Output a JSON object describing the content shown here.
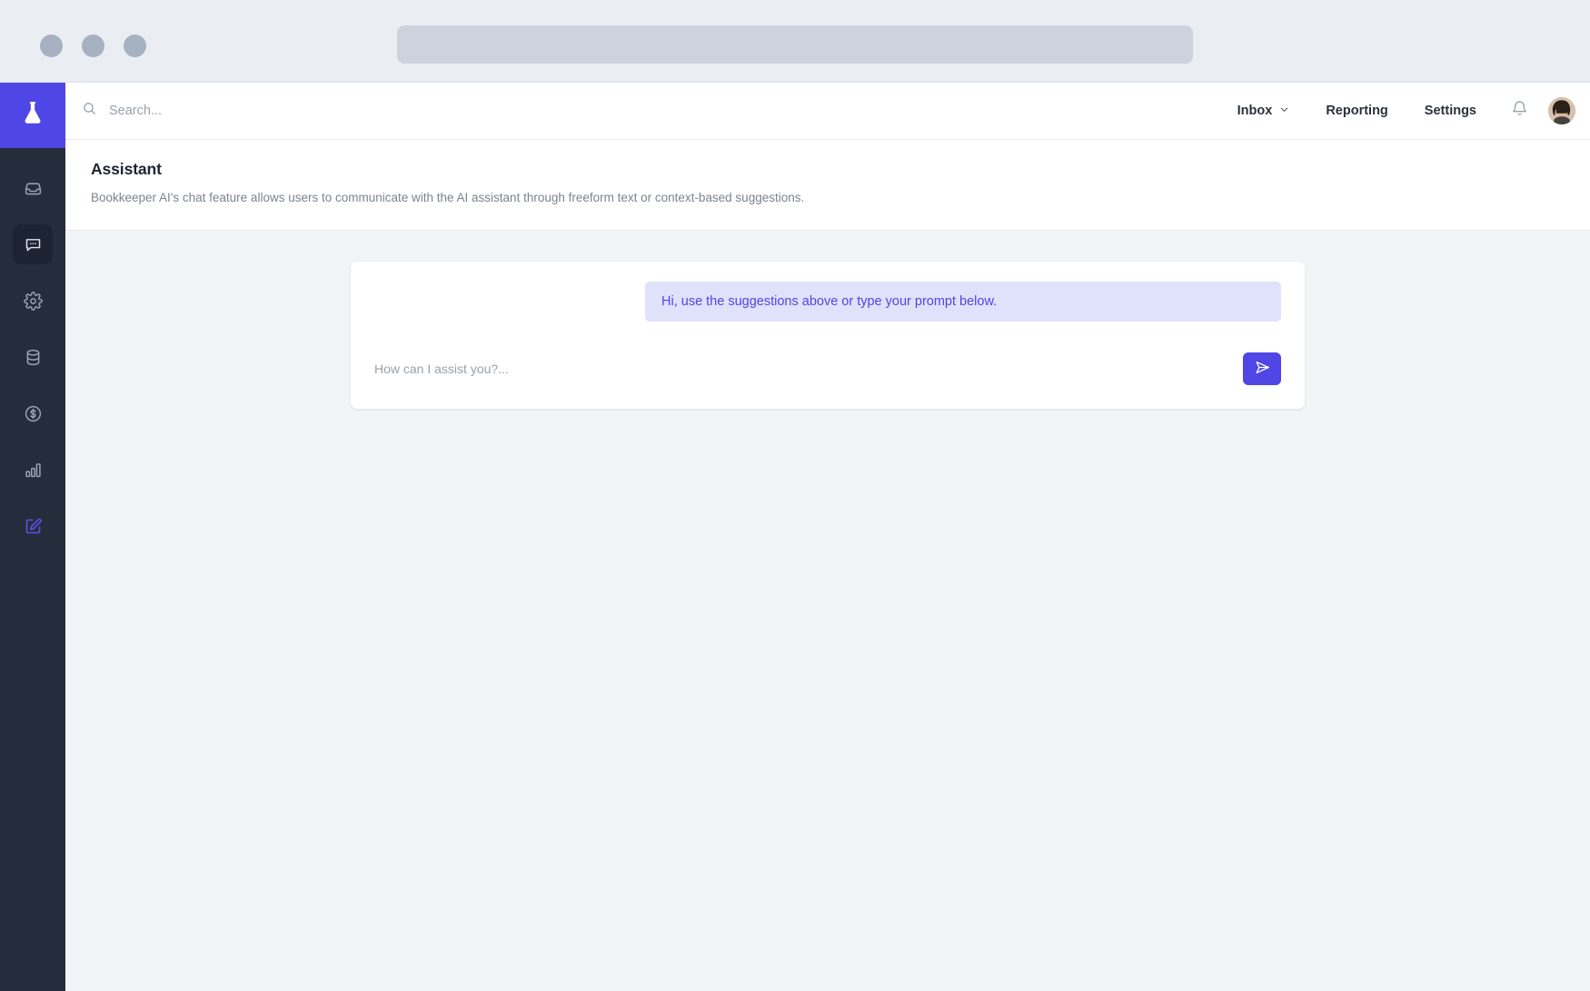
{
  "browser": {
    "traffic_lights": [
      "close",
      "minimize",
      "maximize"
    ],
    "address_value": "",
    "address_placeholder": ""
  },
  "brand": {
    "logo_icon": "flask-icon",
    "accent_color": "#4f46e5"
  },
  "sidebar": {
    "background_color": "#252d3d",
    "items": [
      {
        "key": "inbox",
        "icon": "inbox-icon",
        "label": "Inbox",
        "active": false,
        "accent": false
      },
      {
        "key": "chat",
        "icon": "chat-bubble-icon",
        "label": "Assistant",
        "active": true,
        "accent": false
      },
      {
        "key": "settings",
        "icon": "gear-icon",
        "label": "Settings",
        "active": false,
        "accent": false
      },
      {
        "key": "data",
        "icon": "database-icon",
        "label": "Data",
        "active": false,
        "accent": false
      },
      {
        "key": "billing",
        "icon": "dollar-circle-icon",
        "label": "Billing",
        "active": false,
        "accent": false
      },
      {
        "key": "reporting",
        "icon": "bar-chart-icon",
        "label": "Reporting",
        "active": false,
        "accent": false
      },
      {
        "key": "compose",
        "icon": "pencil-square-icon",
        "label": "Compose",
        "active": false,
        "accent": true
      }
    ]
  },
  "header": {
    "search_icon": "search-icon",
    "search_value": "",
    "search_placeholder": "Search...",
    "nav": [
      {
        "key": "inbox",
        "label": "Inbox",
        "has_caret": true
      },
      {
        "key": "reporting",
        "label": "Reporting",
        "has_caret": false
      },
      {
        "key": "settings",
        "label": "Settings",
        "has_caret": false
      }
    ],
    "bell_icon": "bell-icon",
    "avatar_name": "user-avatar"
  },
  "page": {
    "title": "Assistant",
    "subtitle": "Bookkeeper AI's chat feature allows users to communicate with the AI assistant through freeform text or context-based suggestions."
  },
  "chat": {
    "messages": [
      {
        "role": "assistant",
        "text": "Hi, use the suggestions above or type your prompt below.",
        "bubble_color": "#e0e1fa",
        "text_color": "#4f46e5"
      }
    ],
    "composer": {
      "value": "",
      "placeholder": "How can I assist you?...",
      "send_icon": "send-paper-plane-icon",
      "send_button_color": "#4f46e5"
    }
  }
}
